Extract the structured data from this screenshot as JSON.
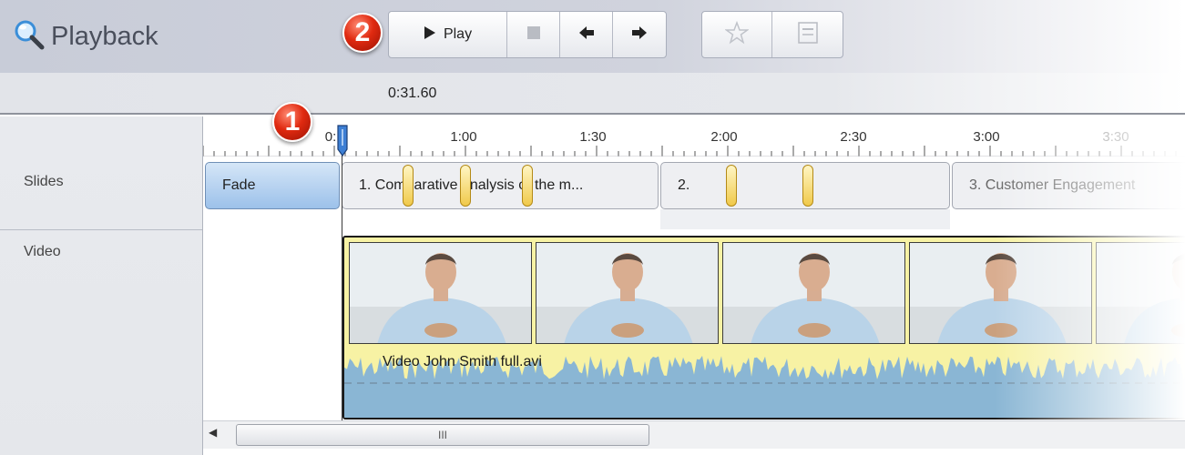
{
  "header": {
    "title": "Playback",
    "title_icon": "magnifier-icon",
    "play_label": "Play"
  },
  "badges": {
    "one": "1",
    "two": "2"
  },
  "timebar": {
    "current_time": "0:31.60"
  },
  "ruler": {
    "ticks": [
      "0:",
      "1:00",
      "1:30",
      "2:00",
      "2:30",
      "3:00",
      "3:30"
    ]
  },
  "tracks": {
    "slides_label": "Slides",
    "video_label": "Video"
  },
  "slides": [
    {
      "label": "Fade"
    },
    {
      "label": "1. Comparative analysis of the m..."
    },
    {
      "label": "2."
    },
    {
      "label": "3. Customer Engagement"
    }
  ],
  "video": {
    "clip_name": "Video John Smith full.avi"
  },
  "scrollbar": {
    "grip": "III"
  },
  "colors": {
    "accent_blue": "#9cc1ea",
    "marker_yellow": "#f0c94a",
    "waveform": "#8ab6d4",
    "badge_red": "#e02a10"
  }
}
